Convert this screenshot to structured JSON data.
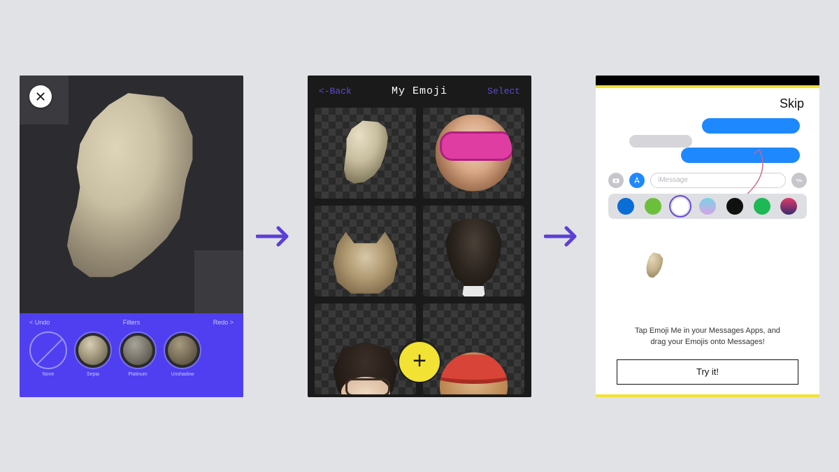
{
  "arrow_color": "#5b3fd6",
  "panel1": {
    "close_label": "Close",
    "undo": "< Undo",
    "filters_label": "Filters",
    "redo": "Redo >",
    "filters": [
      "None",
      "Sepia",
      "Platinum",
      "Unshadow"
    ]
  },
  "panel2": {
    "back": "<-Back",
    "title": "My Emoji",
    "select": "Select",
    "add_label": "+",
    "cells": [
      "man-face",
      "girl-sunglasses",
      "cat",
      "pug-dog",
      "man-glasses",
      "man-sombrero"
    ]
  },
  "panel3": {
    "skip": "Skip",
    "imessage_placeholder": "iMessage",
    "tip_line1": "Tap Emoji Me in your Messages Apps, and",
    "tip_line2": "drag your Emojis onto Messages!",
    "try": "Try it!",
    "drawer_apps": [
      "dropbox",
      "eyes",
      "emoji-me",
      "stickers",
      "loop",
      "spotify",
      "mask"
    ]
  }
}
